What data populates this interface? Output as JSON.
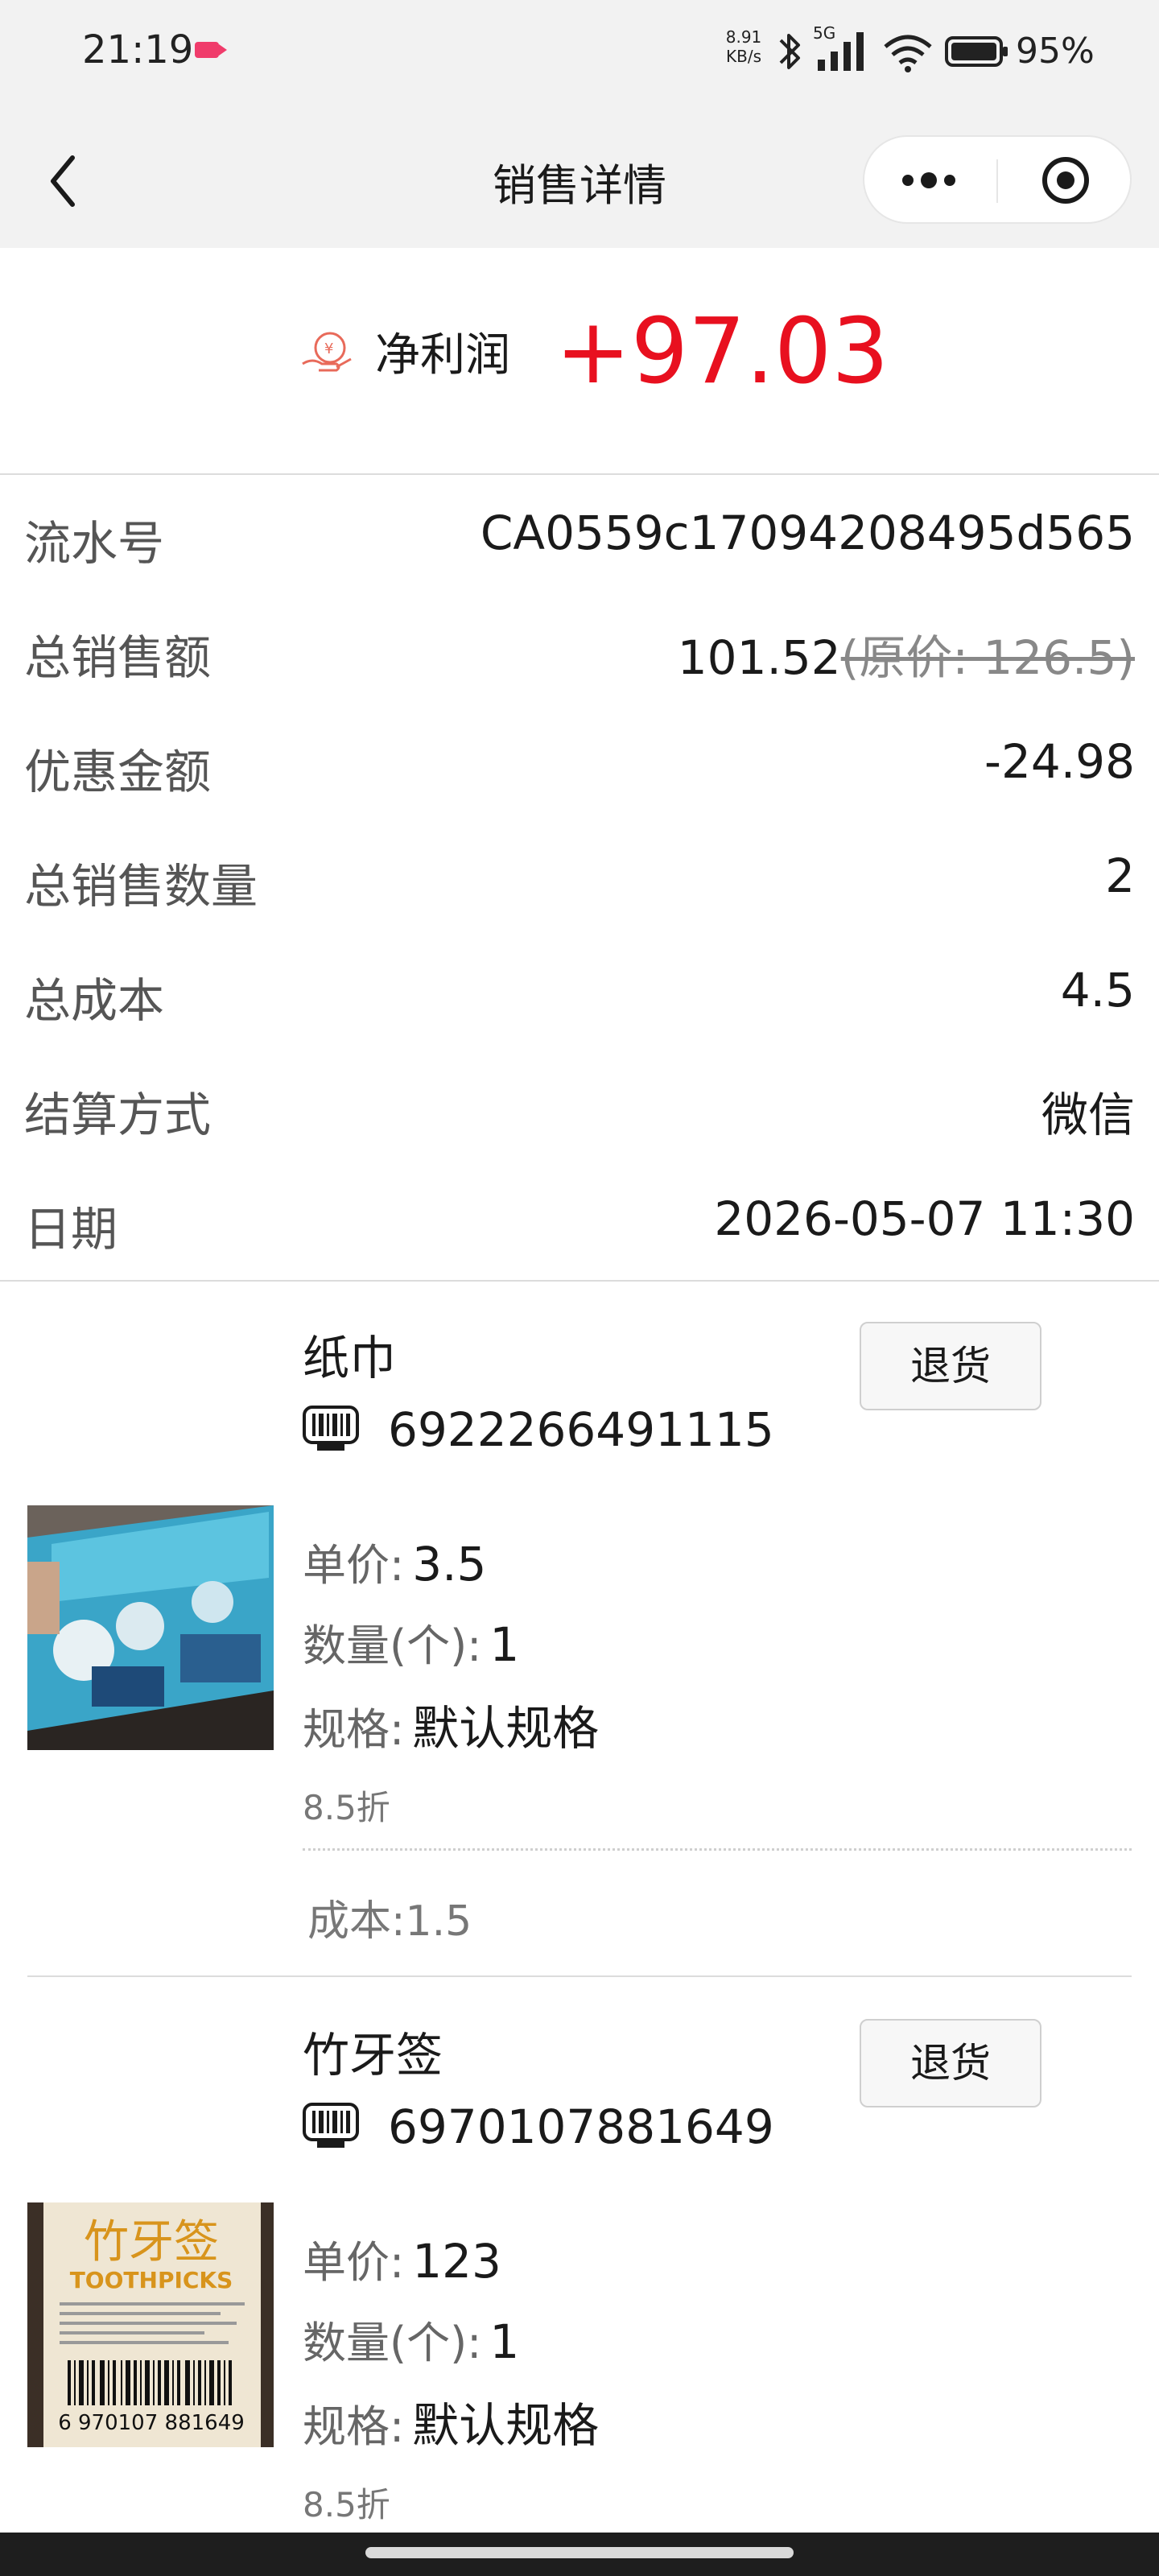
{
  "status_bar": {
    "time": "21:19",
    "net_speed_top": "8.91",
    "net_speed_bottom": "KB/s",
    "signal_label": "5G",
    "battery": "95%"
  },
  "nav": {
    "title": "销售详情"
  },
  "profit": {
    "label": "净利润",
    "value": "+97.03",
    "color": "#e8101f"
  },
  "details": {
    "serial": {
      "label": "流水号",
      "value": "CA0559c17094208495d565"
    },
    "total_sales": {
      "label": "总销售额",
      "value": "101.52",
      "original": "(原价: 126.5)"
    },
    "discount": {
      "label": "优惠金额",
      "value": "-24.98"
    },
    "quantity": {
      "label": "总销售数量",
      "value": "2"
    },
    "cost": {
      "label": "总成本",
      "value": "4.5"
    },
    "payment": {
      "label": "结算方式",
      "value": "微信"
    },
    "date": {
      "label": "日期",
      "value": "2026-05-07 11:30"
    }
  },
  "products": [
    {
      "name": "纸巾",
      "barcode": "6922266491115",
      "return_label": "退货",
      "price_label": "单价:",
      "price": "3.5",
      "qty_label": "数量(个):",
      "qty": "1",
      "spec_label": "规格:",
      "spec": "默认规格",
      "discount": "8.5折",
      "cost": "成本:1.5"
    },
    {
      "name": "竹牙签",
      "barcode": "6970107881649",
      "return_label": "退货",
      "price_label": "单价:",
      "price": "123",
      "qty_label": "数量(个):",
      "qty": "1",
      "spec_label": "规格:",
      "spec": "默认规格",
      "discount": "8.5折",
      "image_text_cn": "竹牙签",
      "image_text_en": "TOOTHPICKS",
      "image_barcode": "6 970107 881649"
    }
  ]
}
